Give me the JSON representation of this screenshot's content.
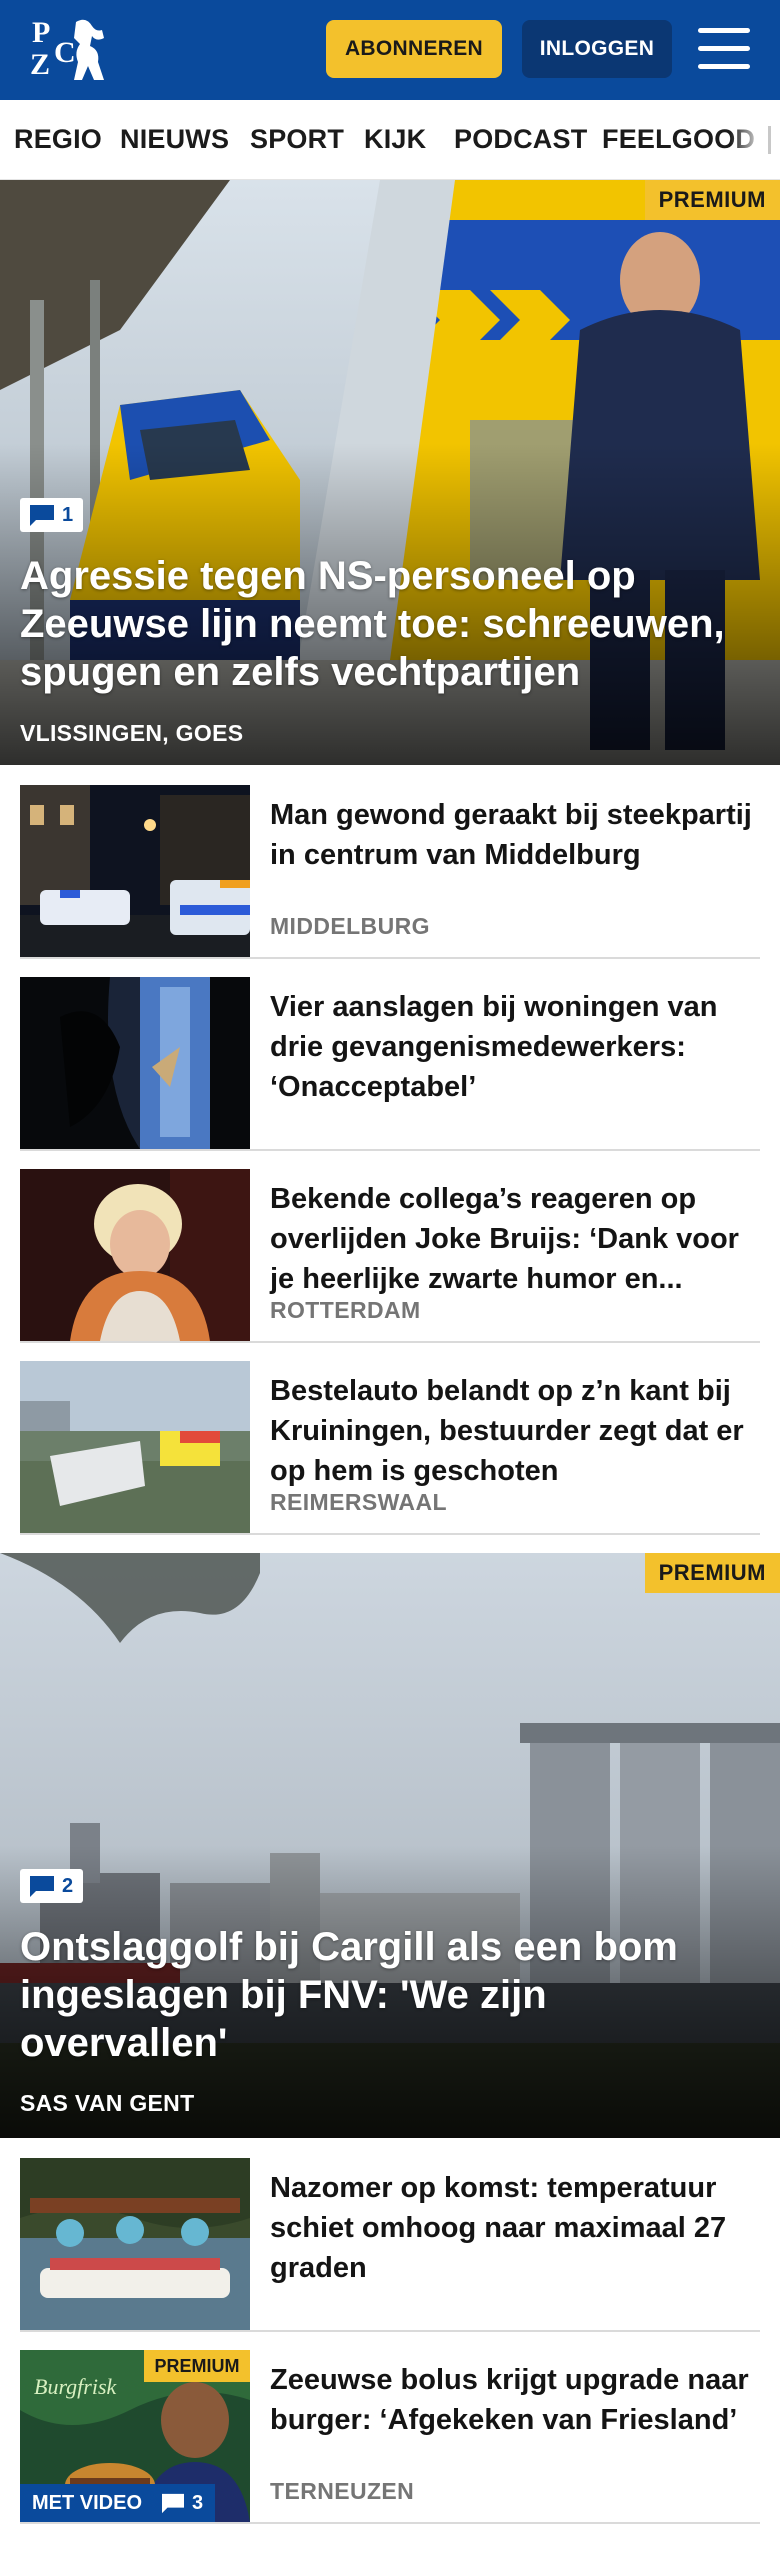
{
  "header": {
    "logo_text": "PZC",
    "subscribe_label": "ABONNEREN",
    "login_label": "INLOGGEN",
    "menu_icon": "hamburger-icon",
    "brand_color": "#0a4a9c",
    "accent_color": "#f3c12c"
  },
  "nav": {
    "items": [
      "REGIO",
      "NIEUWS",
      "SPORT",
      "KIJK",
      "PODCAST",
      "FEELGOOD"
    ]
  },
  "hero1": {
    "premium": "PREMIUM",
    "comments": "1",
    "title": "Agressie tegen NS-personeel op Zeeuwse lijn neemt toe: schreeuwen, spugen en zelfs vechtpartijen",
    "location": "VLISSINGEN, GOES"
  },
  "articles1": [
    {
      "title": "Man gewond geraakt bij steekpartij in centrum van Middelburg",
      "location": "MIDDELBURG"
    },
    {
      "title": "Vier aanslagen bij woningen van drie gevangenismedewerkers: ‘Onacceptabel’",
      "location": ""
    },
    {
      "title": "Bekende collega’s reageren op overlijden Joke Bruijs: ‘Dank voor je heerlijke zwarte humor en...",
      "location": "ROTTERDAM"
    },
    {
      "title": "Bestelauto belandt op z’n kant bij Kruiningen, bestuurder zegt dat er op hem is geschoten",
      "location": "REIMERSWAAL"
    }
  ],
  "hero2": {
    "premium": "PREMIUM",
    "comments": "2",
    "title": "Ontslaggolf bij Cargill als een bom ingeslagen bij FNV: 'We zijn overvallen'",
    "location": "SAS VAN GENT"
  },
  "articles2": [
    {
      "title": "Nazomer op komst: temperatuur schiet omhoog naar maximaal 27 graden",
      "location": ""
    },
    {
      "title": "Zeeuwse bolus krijgt upgrade naar burger: ‘Afgekeken van Friesland’",
      "location": "TERNEUZEN",
      "premium": "PREMIUM",
      "video": "MET VIDEO",
      "comments": "3"
    }
  ]
}
